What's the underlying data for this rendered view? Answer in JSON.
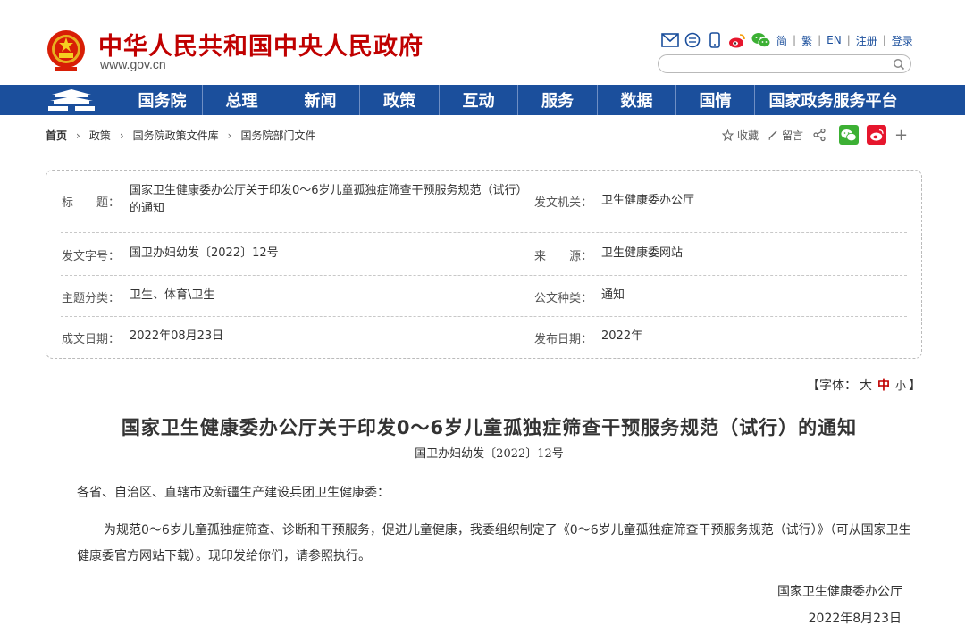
{
  "header": {
    "title": "中华人民共和国中央人民政府",
    "domain": "www.gov.cn",
    "links": [
      "简",
      "繁",
      "EN",
      "注册",
      "登录"
    ],
    "search_value": ""
  },
  "nav": {
    "items": [
      "国务院",
      "总理",
      "新闻",
      "政策",
      "互动",
      "服务",
      "数据",
      "国情",
      "国家政务服务平台"
    ]
  },
  "breadcrumb": [
    "首页",
    "政策",
    "国务院政策文件库",
    "国务院部门文件"
  ],
  "share": {
    "collect": "收藏",
    "comment": "留言"
  },
  "meta": {
    "title_label": "标　　题：",
    "title_value": "国家卫生健康委办公厅关于印发0～6岁儿童孤独症筛查干预服务规范（试行）的通知",
    "issuer_label": "发文机关：",
    "issuer_value": "卫生健康委办公厅",
    "docno_label": "发文字号：",
    "docno_value": "国卫办妇幼发〔2022〕12号",
    "source_label": "来　　源：",
    "source_value": "卫生健康委网站",
    "topic_label": "主题分类：",
    "topic_value": "卫生、体育\\卫生",
    "type_label": "公文种类：",
    "type_value": "通知",
    "date_label": "成文日期：",
    "date_value": "2022年08月23日",
    "pub_label": "发布日期：",
    "pub_value": "2022年"
  },
  "font_size": {
    "prefix": "【字体：",
    "large": "大",
    "medium": "中",
    "small": "小",
    "suffix": "】"
  },
  "article": {
    "title": "国家卫生健康委办公厅关于印发0～6岁儿童孤独症筛查干预服务规范（试行）的通知",
    "doc_no": "国卫办妇幼发〔2022〕12号",
    "salutation": "各省、自治区、直辖市及新疆生产建设兵团卫生健康委：",
    "body": "为规范0～6岁儿童孤独症筛查、诊断和干预服务，促进儿童健康，我委组织制定了《0～6岁儿童孤独症筛查干预服务规范（试行）》（可从国家卫生健康委官方网站下载）。现印发给你们，请参照执行。",
    "signature": "国家卫生健康委办公厅",
    "date": "2022年8月23日"
  },
  "colors": {
    "brand_red": "#c00000",
    "nav_blue": "#1b4f9c",
    "wechat_green": "#3cb034",
    "weibo_red": "#e6162d"
  }
}
